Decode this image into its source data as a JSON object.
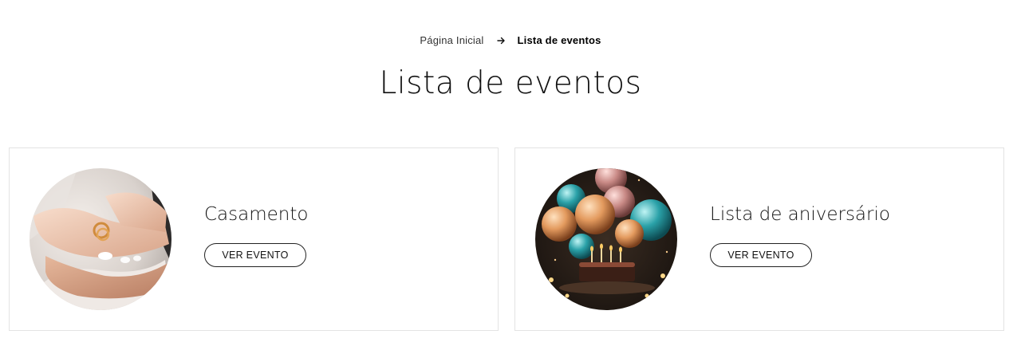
{
  "breadcrumb": {
    "home": "Página Inicial",
    "current": "Lista de eventos"
  },
  "page": {
    "title": "Lista de eventos"
  },
  "cards": [
    {
      "title": "Casamento",
      "button": "VER EVENTO",
      "image": "wedding-rings-hands-photo"
    },
    {
      "title": "Lista de aniversário",
      "button": "VER EVENTO",
      "image": "birthday-balloons-cake-photo"
    }
  ]
}
